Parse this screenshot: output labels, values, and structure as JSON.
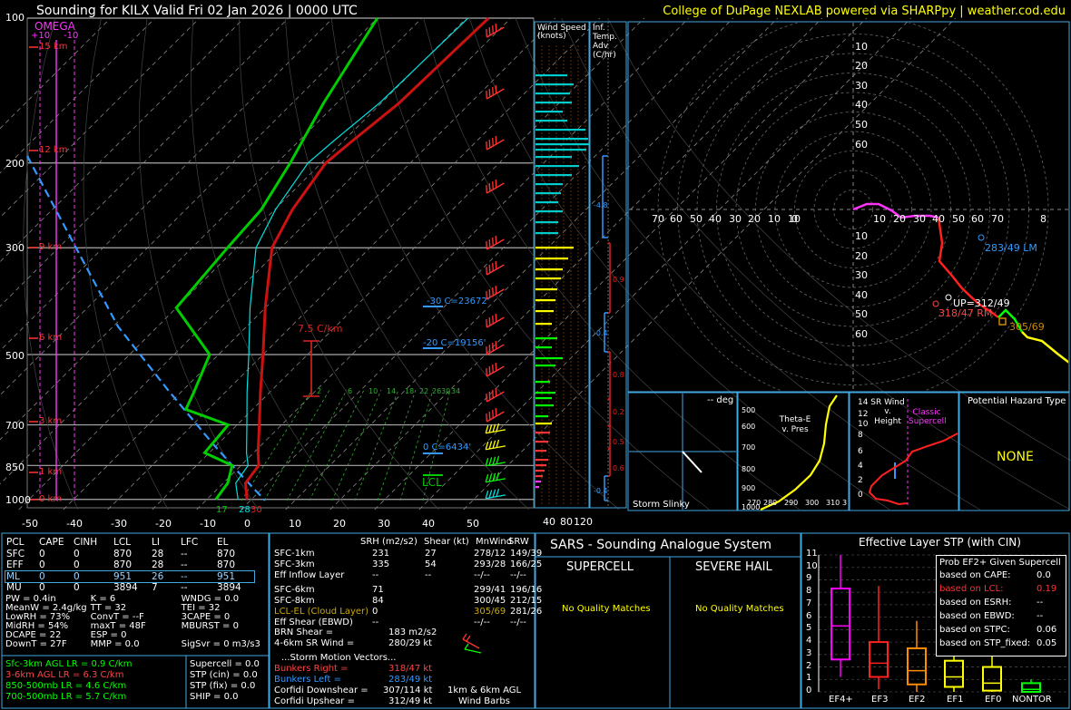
{
  "header": {
    "title": "Sounding for KILX Valid  Fri 02 Jan 2026 | 0000 UTC",
    "credit": "College of DuPage NEXLAB powered via SHARPpy | weather.cod.edu"
  },
  "colors": {
    "temperature": "#cc1111",
    "dewpoint": "#00cc00",
    "wetbulb": "#00e0e0",
    "parcel": "#3399ff",
    "omega": "#ff33ff",
    "isobar": "#aaaaaa",
    "panel_border": "#3fa9e0",
    "credit": "#ffff00"
  },
  "skewt": {
    "omega_label": "OMEGA",
    "omega_ticks": [
      "+10",
      "-10"
    ],
    "pressure_labels": [
      "100",
      "200",
      "300",
      "500",
      "700",
      "850",
      "1000"
    ],
    "height_labels": [
      "15 km",
      "12 km",
      "9 km",
      "6 km",
      "3 km",
      "1 km",
      "0 km"
    ],
    "x_labels": [
      "-50",
      "-40",
      "-30",
      "-20",
      "-10",
      "0",
      "10",
      "20",
      "30",
      "40",
      "50"
    ],
    "lapse_rate_label": "7.5 C/km",
    "mixing_ratio_labels": [
      "2",
      "6",
      "10",
      "14",
      "18",
      "22",
      "26",
      "30",
      "34"
    ],
    "levels": [
      "-30 C=23672'",
      "-20 C=19156'",
      "0 C=6434'"
    ],
    "lcl_label": "LCL",
    "surface_labels": [
      "17",
      "28",
      "30"
    ]
  },
  "chart_data": {
    "type": "line",
    "title": "Sounding for KILX Valid  Fri 02 Jan 2026 | 0000 UTC",
    "xlabel": "",
    "ylabel": "",
    "x_axis_temperature_c": [
      -50,
      -40,
      -30,
      -20,
      -10,
      0,
      10,
      20,
      30,
      40,
      50
    ],
    "pressure_levels_mb": [
      1000,
      850,
      700,
      500,
      300,
      200,
      100
    ],
    "series": [
      {
        "name": "Temperature",
        "pressure_mb": [
          1000,
          925,
          850,
          800,
          700,
          600,
          500,
          400,
          300,
          250,
          200,
          180,
          150,
          100
        ],
        "temp_c": [
          -1,
          -5,
          -6,
          -9,
          -15,
          -22,
          -30,
          -40,
          -52,
          -56,
          -59,
          -58,
          -56,
          -55
        ]
      },
      {
        "name": "Dewpoint",
        "pressure_mb": [
          1000,
          925,
          850,
          800,
          700,
          650,
          600,
          500,
          400,
          300,
          250,
          200,
          150,
          100
        ],
        "temp_c": [
          -8,
          -9,
          -12,
          -21,
          -22,
          -35,
          -37,
          -42,
          -60,
          -62,
          -63,
          -67,
          -73,
          -80
        ]
      }
    ],
    "wind_speed_axis_knots": [
      40,
      80,
      120
    ],
    "hodograph_rings_knots": [
      10,
      20,
      30,
      40,
      50,
      60
    ],
    "hodograph_axis_labels": [
      "0",
      "10",
      "20",
      "30",
      "40",
      "50",
      "60",
      "70",
      "80"
    ]
  },
  "wind_panel": {
    "title": "Wind Speed (knots)",
    "ticks": [
      "40",
      "80",
      "120"
    ]
  },
  "tadv_panel": {
    "title": "Inf. Temp. Adv (C/hr)",
    "values": [
      "-4.8",
      "0.9",
      "-0.4",
      "0.8",
      "0.2",
      "0.5",
      "0.6",
      "-0.4"
    ]
  },
  "hodograph": {
    "rm_label": "318/47 RM",
    "lm_label": "283/49 LM",
    "up_label": "UP=312/49",
    "mean_label": "305/69",
    "ring_labels": [
      "10",
      "20",
      "30",
      "40",
      "50",
      "60"
    ],
    "x_labels_left": [
      "80",
      "70",
      "60",
      "50",
      "40",
      "30",
      "20",
      "10"
    ],
    "x_labels_right": [
      "10",
      "20",
      "30",
      "40",
      "50",
      "60",
      "70",
      "8"
    ]
  },
  "slinky": {
    "deg": "-- deg",
    "title": "Storm Slinky"
  },
  "theta": {
    "title": "Theta-E v. Pres",
    "y_labels": [
      "500",
      "600",
      "700",
      "800",
      "900",
      "1000"
    ],
    "x_labels": [
      "270",
      "280",
      "290",
      "300",
      "310",
      "3"
    ]
  },
  "srwind": {
    "title": "SR Wind v. Height",
    "classic": "Classic Supercell",
    "y_labels": [
      "14",
      "12",
      "10",
      "8",
      "6",
      "4",
      "2",
      "0"
    ]
  },
  "hazard": {
    "title": "Potential Hazard Type",
    "value": "NONE"
  },
  "parcels": {
    "headers": [
      "PCL",
      "CAPE",
      "CINH",
      "LCL",
      "LI",
      "LFC",
      "EL"
    ],
    "rows": [
      [
        "SFC",
        "0",
        "0",
        "870",
        "28",
        "--",
        "870"
      ],
      [
        "EFF",
        "0",
        "0",
        "870",
        "28",
        "--",
        "870"
      ],
      [
        "ML",
        "0",
        "0",
        "951",
        "26",
        "--",
        "951"
      ],
      [
        "MU",
        "0",
        "0",
        "3894",
        "7",
        "--",
        "3894"
      ]
    ]
  },
  "indices": {
    "col1": [
      "PW = 0.4in",
      "MeanW = 2.4g/kg",
      "LowRH = 73%",
      "MidRH = 54%",
      "DCAPE = 22",
      "DownT = 27F"
    ],
    "col2": [
      "K = 6",
      "TT = 32",
      "ConvT = --F",
      "maxT = 48F",
      "ESP = 0",
      "MMP = 0.0"
    ],
    "col3": [
      "WNDG = 0.0",
      "TEI = 32",
      "3CAPE = 0",
      "MBURST = 0",
      "",
      "SigSvr = 0 m3/s3"
    ]
  },
  "lapse": [
    "Sfc-3km AGL LR = 0.9 C/km",
    "3-6km AGL LR = 6.3 C/km",
    "850-500mb LR = 4.6 C/km",
    "700-500mb LR = 5.7 C/km"
  ],
  "params": [
    "Supercell = 0.0",
    "STP (cin) = 0.0",
    "STP (fix) = 0.0",
    "SHIP = 0.0"
  ],
  "kinematic": {
    "headers": [
      "SRH (m2/s2)",
      "Shear (kt)",
      "MnWind",
      "SRW"
    ],
    "rows": [
      [
        "SFC-1km",
        "231",
        "27",
        "278/12",
        "149/39"
      ],
      [
        "SFC-3km",
        "335",
        "54",
        "293/28",
        "166/25"
      ],
      [
        "Eff Inflow Layer",
        "--",
        "--",
        "--/--",
        "--/--"
      ],
      [
        "SFC-6km",
        "71",
        "299/41",
        "196/16",
        ""
      ],
      [
        "SFC-8km",
        "84",
        "300/45",
        "212/15",
        ""
      ],
      [
        "LCL-EL (Cloud Layer)",
        "0",
        "305/69",
        "281/26",
        ""
      ],
      [
        "Eff Shear (EBWD)",
        "--",
        "--/--",
        "--/--",
        ""
      ]
    ],
    "brn_shear": "BRN Shear =",
    "brn_shear_val": "183 m2/s2",
    "sr_wind": "4-6km SR Wind =",
    "sr_wind_val": "280/29 kt",
    "storm_title": "...Storm Motion Vectors...",
    "bunkers_right": "Bunkers Right =",
    "bunkers_right_val": "318/47 kt",
    "bunkers_left": "Bunkers Left =",
    "bunkers_left_val": "283/49 kt",
    "corfidi_down": "Corfidi Downshear =",
    "corfidi_down_val": "307/114 kt",
    "corfidi_up": "Corfidi Upshear =",
    "corfidi_up_val": "312/49 kt",
    "barbs_label_1": "1km & 6km AGL",
    "barbs_label_2": "Wind Barbs"
  },
  "sars": {
    "title": "SARS - Sounding Analogue System",
    "supercell": "SUPERCELL",
    "hail": "SEVERE HAIL",
    "no_match_1": "No Quality Matches",
    "no_match_2": "No Quality Matches"
  },
  "stp": {
    "title": "Effective Layer STP (with CIN)",
    "prob_title": "Prob EF2+ Given Supercell",
    "prob_rows": [
      [
        "based on CAPE:",
        "0.0"
      ],
      [
        "based on LCL:",
        "0.19"
      ],
      [
        "based on ESRH:",
        "--"
      ],
      [
        "based on EBWD:",
        "--"
      ],
      [
        "based on STPC:",
        "0.06"
      ],
      [
        "based on STP_fixed:",
        "0.05"
      ]
    ],
    "y_labels": [
      "11",
      "10",
      "9",
      "8",
      "7",
      "6",
      "5",
      "4",
      "3",
      "2",
      "1",
      "0"
    ],
    "categories": [
      "EF4+",
      "EF3",
      "EF2",
      "EF1",
      "EF0",
      "NONTOR"
    ],
    "box_colors": [
      "#ff00ff",
      "#ff2020",
      "#ff8c00",
      "#ffff00",
      "#ffff00",
      "#00ff00"
    ],
    "boxes": [
      {
        "whisker_low": 1.2,
        "q1": 2.6,
        "median": 5.3,
        "q3": 8.3,
        "whisker_high": 11.0
      },
      {
        "whisker_low": 0.2,
        "q1": 1.2,
        "median": 2.3,
        "q3": 4.0,
        "whisker_high": 8.5
      },
      {
        "whisker_low": 0.0,
        "q1": 0.6,
        "median": 1.7,
        "q3": 3.5,
        "whisker_high": 5.7
      },
      {
        "whisker_low": 0.0,
        "q1": 0.4,
        "median": 1.2,
        "q3": 2.5,
        "whisker_high": 4.0
      },
      {
        "whisker_low": 0.0,
        "q1": 0.1,
        "median": 0.7,
        "q3": 2.0,
        "whisker_high": 3.7
      },
      {
        "whisker_low": 0.0,
        "q1": 0.0,
        "median": 0.2,
        "q3": 0.7,
        "whisker_high": 1.0
      }
    ]
  }
}
